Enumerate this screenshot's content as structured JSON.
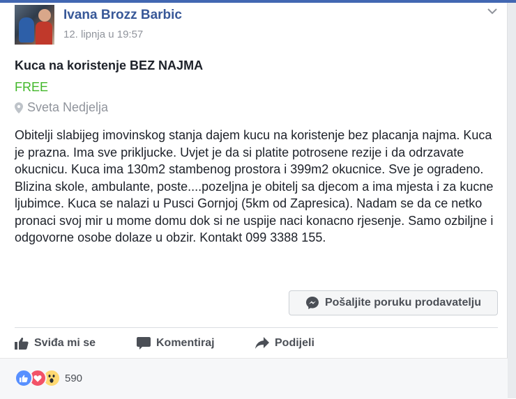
{
  "post": {
    "author": "Ivana Brozz Barbic",
    "timestamp": "12. lipnja u 19:57",
    "title": "Kuca na koristenje BEZ NAJMA",
    "price": "FREE",
    "location": "Sveta Nedjelja",
    "description": "Obitelji slabijeg imovinskog stanja dajem kucu na koristenje bez placanja najma. Kuca je prazna. Ima sve prikljucke. Uvjet je da si platite potrosene rezije i da odrzavate okucnicu. Kuca ima 130m2 stambenog prostora i 399m2 okucnice. Sve je ogradeno. Blizina skole, ambulante, poste....pozeljna je obitelj sa djecom a ima mjesta i za kucne ljubimce. Kuca se nalazi u Pusci Gornjoj (5km od Zapresica). Nadam se da ce netko pronaci svoj mir u mome domu dok si ne uspije naci konacno rjesenje. Samo ozbiljne i odgovorne osobe dolaze u obzir. Kontakt 099 3388 155.",
    "message_button": "Pošaljite poruku prodavatelju"
  },
  "actions": {
    "like": "Sviđa mi se",
    "comment": "Komentiraj",
    "share": "Podijeli"
  },
  "reactions": {
    "types": [
      "like",
      "love",
      "wow"
    ],
    "count": "590"
  },
  "icons": {
    "options": "chevron-down-icon",
    "location": "map-pin-icon",
    "messenger": "messenger-icon",
    "like": "thumbs-up-icon",
    "comment": "comment-bubble-icon",
    "share": "share-arrow-icon"
  },
  "colors": {
    "brand": "#4267b2",
    "author": "#385898",
    "price": "#42b72a",
    "muted": "#90949c"
  }
}
